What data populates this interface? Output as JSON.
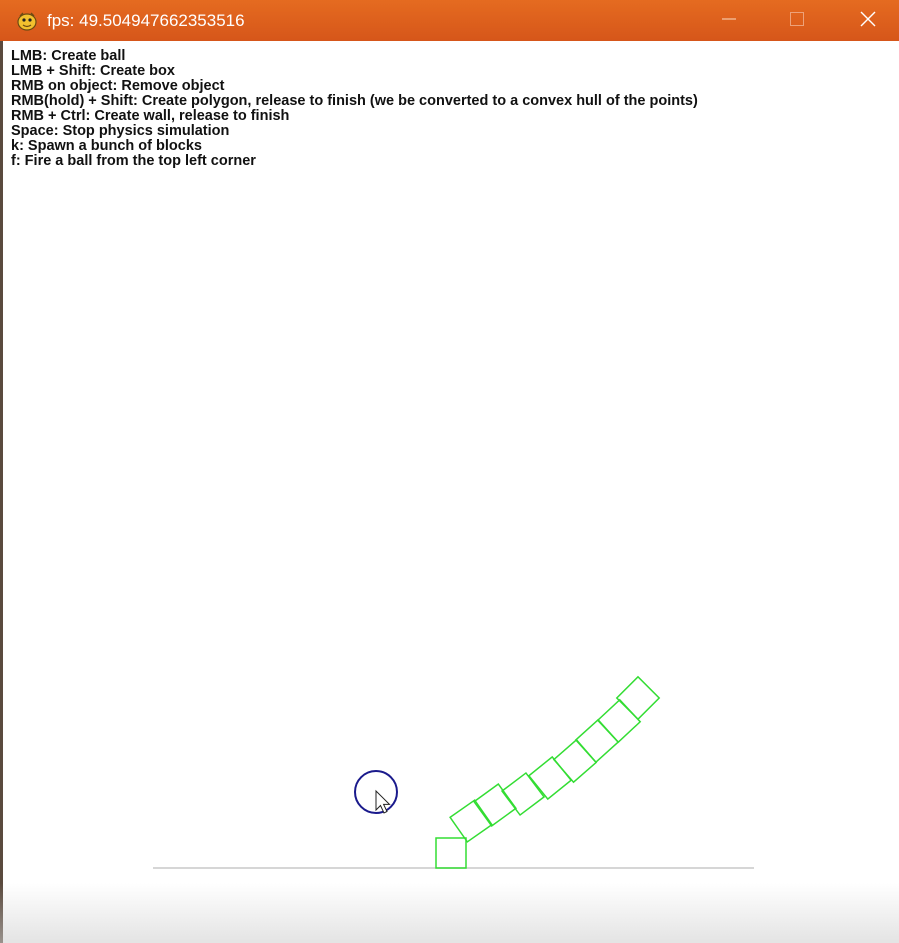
{
  "window": {
    "title": "fps: 49.504947662353516",
    "app_icon": "pygame-snake-icon",
    "controls": {
      "minimize": "minimize-icon",
      "maximize": "maximize-icon",
      "close": "close-icon"
    },
    "titlebar_color": "#dd5f1c"
  },
  "instructions": [
    "LMB: Create ball",
    "LMB + Shift: Create box",
    "RMB on object: Remove object",
    "RMB(hold) + Shift: Create polygon, release to finish (we be converted to a convex hull of the points)",
    "RMB + Ctrl: Create wall, release to finish",
    "Space: Stop physics simulation",
    "k: Spawn a bunch of blocks",
    "f: Fire a ball from the top left corner"
  ],
  "scene": {
    "ground_color": "#c8c8c8",
    "box_color": "#33dd33",
    "ball_color": "#1a1a8c",
    "box_count": 10,
    "ball_count": 1,
    "cursor": "mouse-pointer-icon"
  }
}
